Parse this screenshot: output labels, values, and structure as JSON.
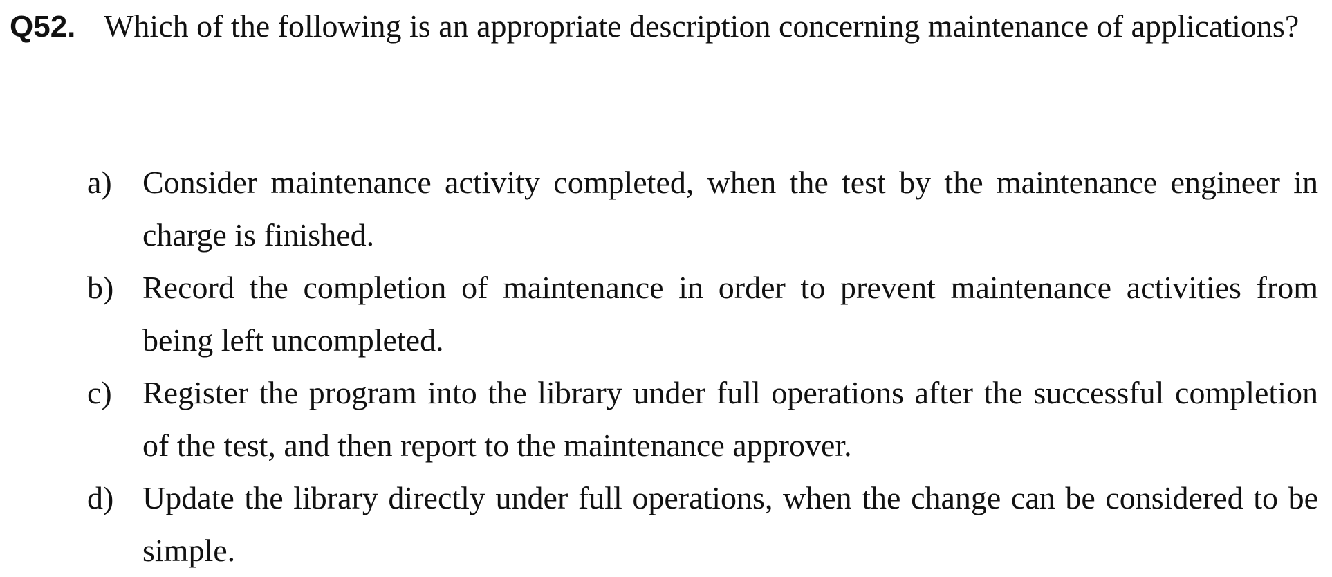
{
  "question": {
    "number": "Q52.",
    "text": "Which of the following is an appropriate description concerning maintenance of applications?"
  },
  "options": [
    {
      "label": "a)",
      "text": "Consider maintenance activity completed, when the test by the maintenance engineer in charge is finished."
    },
    {
      "label": "b)",
      "text": "Record the completion of maintenance in order to prevent maintenance activities from being left uncompleted."
    },
    {
      "label": "c)",
      "text": "Register the program into the library under full operations after the successful completion of the test, and then report to the maintenance approver."
    },
    {
      "label": "d)",
      "text": "Update the library directly under full operations, when the change can be considered to be simple."
    }
  ]
}
